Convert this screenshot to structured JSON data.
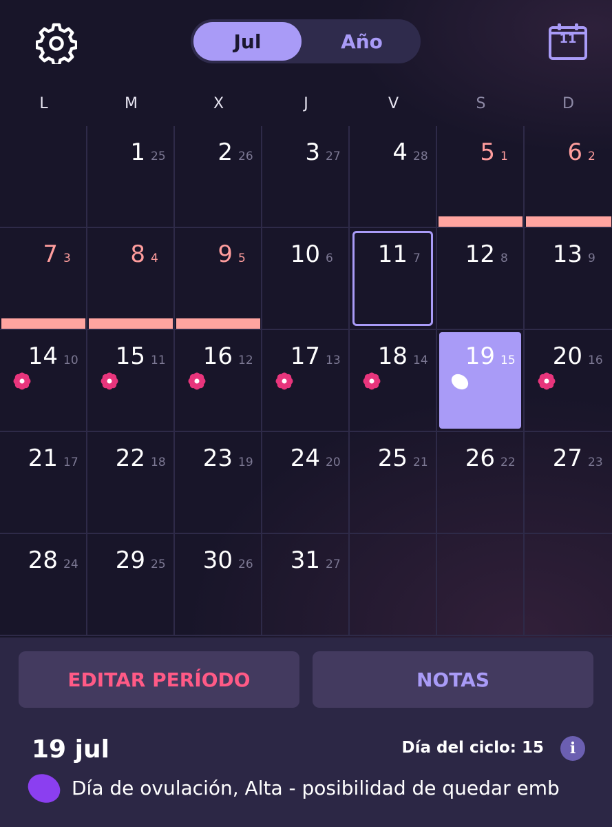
{
  "header": {
    "settings_icon": "gear-icon",
    "segment": {
      "active": "Jul",
      "inactive": "Año"
    },
    "today_icon": "calendar-icon",
    "today_number": "11"
  },
  "weekdays": [
    "L",
    "M",
    "X",
    "J",
    "V",
    "S",
    "D"
  ],
  "calendar": {
    "days": [
      {
        "day": "1",
        "cycle": "25"
      },
      {
        "day": "2",
        "cycle": "26"
      },
      {
        "day": "3",
        "cycle": "27"
      },
      {
        "day": "4",
        "cycle": "28"
      },
      {
        "day": "5",
        "cycle": "1",
        "period": true
      },
      {
        "day": "6",
        "cycle": "2",
        "period": true
      },
      {
        "day": "7",
        "cycle": "3",
        "period": true
      },
      {
        "day": "8",
        "cycle": "4",
        "period": true
      },
      {
        "day": "9",
        "cycle": "5",
        "period": true
      },
      {
        "day": "10",
        "cycle": "6"
      },
      {
        "day": "11",
        "cycle": "7",
        "today": true
      },
      {
        "day": "12",
        "cycle": "8"
      },
      {
        "day": "13",
        "cycle": "9"
      },
      {
        "day": "14",
        "cycle": "10",
        "fertile": true
      },
      {
        "day": "15",
        "cycle": "11",
        "fertile": true
      },
      {
        "day": "16",
        "cycle": "12",
        "fertile": true
      },
      {
        "day": "17",
        "cycle": "13",
        "fertile": true
      },
      {
        "day": "18",
        "cycle": "14",
        "fertile": true
      },
      {
        "day": "19",
        "cycle": "15",
        "selected": true,
        "ovulation": true
      },
      {
        "day": "20",
        "cycle": "16",
        "fertile": true
      },
      {
        "day": "21",
        "cycle": "17"
      },
      {
        "day": "22",
        "cycle": "18"
      },
      {
        "day": "23",
        "cycle": "19"
      },
      {
        "day": "24",
        "cycle": "20"
      },
      {
        "day": "25",
        "cycle": "21"
      },
      {
        "day": "26",
        "cycle": "22"
      },
      {
        "day": "27",
        "cycle": "23"
      },
      {
        "day": "28",
        "cycle": "24"
      },
      {
        "day": "29",
        "cycle": "25"
      },
      {
        "day": "30",
        "cycle": "26"
      },
      {
        "day": "31",
        "cycle": "27"
      }
    ],
    "leading_blank_cells": 1,
    "period_color": "#ffa4a0",
    "fertile_color": "#e8357c",
    "selected_color": "#a99bf7"
  },
  "actions": {
    "edit_period": "EDITAR PERÍODO",
    "notes": "NOTAS"
  },
  "details": {
    "date": "19 jul",
    "cycle_day": "Día del ciclo: 15",
    "info_icon": "info-icon",
    "info_glyph": "i",
    "description": "Día de ovulación, Alta - posibilidad de quedar emb",
    "description_icon": "ovulation-egg-icon"
  }
}
